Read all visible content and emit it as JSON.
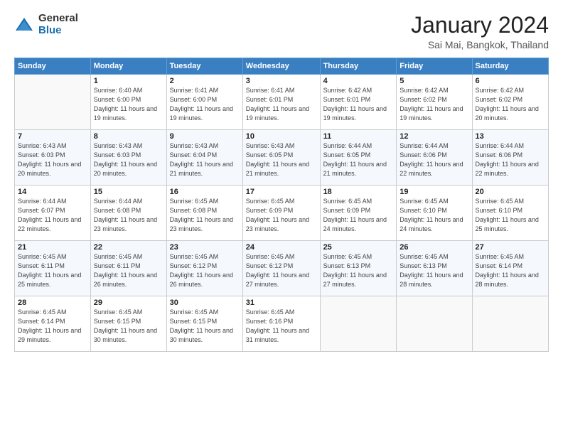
{
  "logo": {
    "general": "General",
    "blue": "Blue"
  },
  "title": "January 2024",
  "location": "Sai Mai, Bangkok, Thailand",
  "days_of_week": [
    "Sunday",
    "Monday",
    "Tuesday",
    "Wednesday",
    "Thursday",
    "Friday",
    "Saturday"
  ],
  "weeks": [
    [
      {
        "day": "",
        "sunrise": "",
        "sunset": "",
        "daylight": ""
      },
      {
        "day": "1",
        "sunrise": "Sunrise: 6:40 AM",
        "sunset": "Sunset: 6:00 PM",
        "daylight": "Daylight: 11 hours and 19 minutes."
      },
      {
        "day": "2",
        "sunrise": "Sunrise: 6:41 AM",
        "sunset": "Sunset: 6:00 PM",
        "daylight": "Daylight: 11 hours and 19 minutes."
      },
      {
        "day": "3",
        "sunrise": "Sunrise: 6:41 AM",
        "sunset": "Sunset: 6:01 PM",
        "daylight": "Daylight: 11 hours and 19 minutes."
      },
      {
        "day": "4",
        "sunrise": "Sunrise: 6:42 AM",
        "sunset": "Sunset: 6:01 PM",
        "daylight": "Daylight: 11 hours and 19 minutes."
      },
      {
        "day": "5",
        "sunrise": "Sunrise: 6:42 AM",
        "sunset": "Sunset: 6:02 PM",
        "daylight": "Daylight: 11 hours and 19 minutes."
      },
      {
        "day": "6",
        "sunrise": "Sunrise: 6:42 AM",
        "sunset": "Sunset: 6:02 PM",
        "daylight": "Daylight: 11 hours and 20 minutes."
      }
    ],
    [
      {
        "day": "7",
        "sunrise": "Sunrise: 6:43 AM",
        "sunset": "Sunset: 6:03 PM",
        "daylight": "Daylight: 11 hours and 20 minutes."
      },
      {
        "day": "8",
        "sunrise": "Sunrise: 6:43 AM",
        "sunset": "Sunset: 6:03 PM",
        "daylight": "Daylight: 11 hours and 20 minutes."
      },
      {
        "day": "9",
        "sunrise": "Sunrise: 6:43 AM",
        "sunset": "Sunset: 6:04 PM",
        "daylight": "Daylight: 11 hours and 21 minutes."
      },
      {
        "day": "10",
        "sunrise": "Sunrise: 6:43 AM",
        "sunset": "Sunset: 6:05 PM",
        "daylight": "Daylight: 11 hours and 21 minutes."
      },
      {
        "day": "11",
        "sunrise": "Sunrise: 6:44 AM",
        "sunset": "Sunset: 6:05 PM",
        "daylight": "Daylight: 11 hours and 21 minutes."
      },
      {
        "day": "12",
        "sunrise": "Sunrise: 6:44 AM",
        "sunset": "Sunset: 6:06 PM",
        "daylight": "Daylight: 11 hours and 22 minutes."
      },
      {
        "day": "13",
        "sunrise": "Sunrise: 6:44 AM",
        "sunset": "Sunset: 6:06 PM",
        "daylight": "Daylight: 11 hours and 22 minutes."
      }
    ],
    [
      {
        "day": "14",
        "sunrise": "Sunrise: 6:44 AM",
        "sunset": "Sunset: 6:07 PM",
        "daylight": "Daylight: 11 hours and 22 minutes."
      },
      {
        "day": "15",
        "sunrise": "Sunrise: 6:44 AM",
        "sunset": "Sunset: 6:08 PM",
        "daylight": "Daylight: 11 hours and 23 minutes."
      },
      {
        "day": "16",
        "sunrise": "Sunrise: 6:45 AM",
        "sunset": "Sunset: 6:08 PM",
        "daylight": "Daylight: 11 hours and 23 minutes."
      },
      {
        "day": "17",
        "sunrise": "Sunrise: 6:45 AM",
        "sunset": "Sunset: 6:09 PM",
        "daylight": "Daylight: 11 hours and 23 minutes."
      },
      {
        "day": "18",
        "sunrise": "Sunrise: 6:45 AM",
        "sunset": "Sunset: 6:09 PM",
        "daylight": "Daylight: 11 hours and 24 minutes."
      },
      {
        "day": "19",
        "sunrise": "Sunrise: 6:45 AM",
        "sunset": "Sunset: 6:10 PM",
        "daylight": "Daylight: 11 hours and 24 minutes."
      },
      {
        "day": "20",
        "sunrise": "Sunrise: 6:45 AM",
        "sunset": "Sunset: 6:10 PM",
        "daylight": "Daylight: 11 hours and 25 minutes."
      }
    ],
    [
      {
        "day": "21",
        "sunrise": "Sunrise: 6:45 AM",
        "sunset": "Sunset: 6:11 PM",
        "daylight": "Daylight: 11 hours and 25 minutes."
      },
      {
        "day": "22",
        "sunrise": "Sunrise: 6:45 AM",
        "sunset": "Sunset: 6:11 PM",
        "daylight": "Daylight: 11 hours and 26 minutes."
      },
      {
        "day": "23",
        "sunrise": "Sunrise: 6:45 AM",
        "sunset": "Sunset: 6:12 PM",
        "daylight": "Daylight: 11 hours and 26 minutes."
      },
      {
        "day": "24",
        "sunrise": "Sunrise: 6:45 AM",
        "sunset": "Sunset: 6:12 PM",
        "daylight": "Daylight: 11 hours and 27 minutes."
      },
      {
        "day": "25",
        "sunrise": "Sunrise: 6:45 AM",
        "sunset": "Sunset: 6:13 PM",
        "daylight": "Daylight: 11 hours and 27 minutes."
      },
      {
        "day": "26",
        "sunrise": "Sunrise: 6:45 AM",
        "sunset": "Sunset: 6:13 PM",
        "daylight": "Daylight: 11 hours and 28 minutes."
      },
      {
        "day": "27",
        "sunrise": "Sunrise: 6:45 AM",
        "sunset": "Sunset: 6:14 PM",
        "daylight": "Daylight: 11 hours and 28 minutes."
      }
    ],
    [
      {
        "day": "28",
        "sunrise": "Sunrise: 6:45 AM",
        "sunset": "Sunset: 6:14 PM",
        "daylight": "Daylight: 11 hours and 29 minutes."
      },
      {
        "day": "29",
        "sunrise": "Sunrise: 6:45 AM",
        "sunset": "Sunset: 6:15 PM",
        "daylight": "Daylight: 11 hours and 30 minutes."
      },
      {
        "day": "30",
        "sunrise": "Sunrise: 6:45 AM",
        "sunset": "Sunset: 6:15 PM",
        "daylight": "Daylight: 11 hours and 30 minutes."
      },
      {
        "day": "31",
        "sunrise": "Sunrise: 6:45 AM",
        "sunset": "Sunset: 6:16 PM",
        "daylight": "Daylight: 11 hours and 31 minutes."
      },
      {
        "day": "",
        "sunrise": "",
        "sunset": "",
        "daylight": ""
      },
      {
        "day": "",
        "sunrise": "",
        "sunset": "",
        "daylight": ""
      },
      {
        "day": "",
        "sunrise": "",
        "sunset": "",
        "daylight": ""
      }
    ]
  ]
}
